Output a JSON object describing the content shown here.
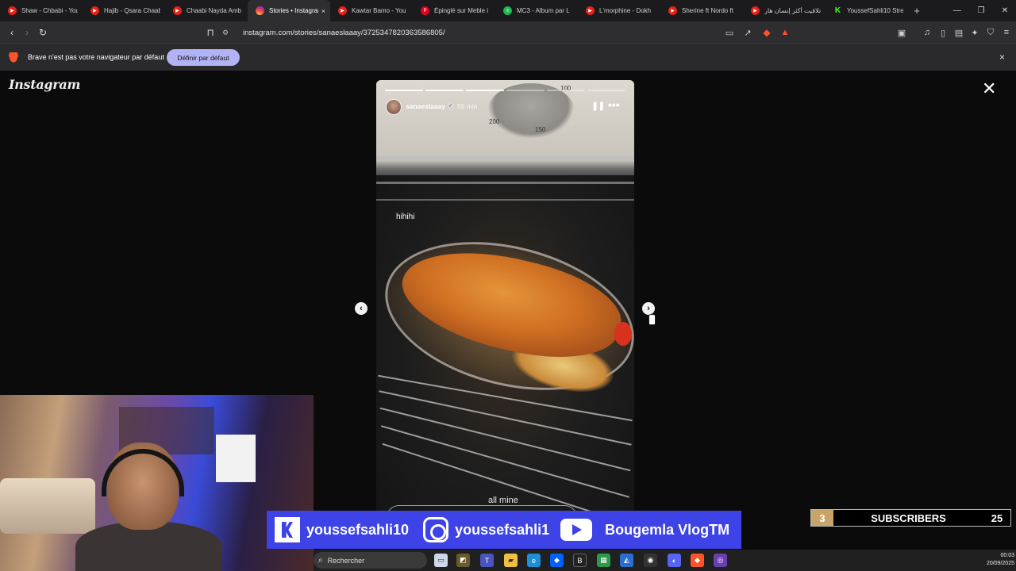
{
  "browser": {
    "tabs": [
      {
        "title": "Shaw - Chbabi - You",
        "icon": "youtube-icon"
      },
      {
        "title": "Hajib - Qsara Chaabi",
        "icon": "youtube-icon"
      },
      {
        "title": "Chaabi Nayda Amb",
        "icon": "youtube-icon"
      },
      {
        "title": "Stories • Instagram",
        "icon": "instagram-icon",
        "active": true
      },
      {
        "title": "Kawtar Bamo - You",
        "icon": "youtube-icon"
      },
      {
        "title": "Épinglé sur Meble i",
        "icon": "pinterest-icon"
      },
      {
        "title": "MC3 - Album par L",
        "icon": "spotify-icon"
      },
      {
        "title": "L'morphine - Dokh",
        "icon": "youtube-icon"
      },
      {
        "title": "Sherine ft Nordo ft",
        "icon": "youtube-icon"
      },
      {
        "title": "تلاقيت أكثر إنسان هار",
        "icon": "youtube-icon"
      },
      {
        "title": "YoussefSahli10 Stre",
        "icon": "kick-icon"
      }
    ],
    "new_tab": "+",
    "close_tab": "×",
    "url": "instagram.com/stories/sanaeslaaay/3725347820363586805/",
    "colors": {
      "brave": "#fb542b",
      "accent_button": "#b2b3f5"
    }
  },
  "infobar": {
    "message": "Brave n'est pas votre navigateur par défaut",
    "button": "Définir par défaut",
    "close": "×"
  },
  "instagram": {
    "logo": "Instagram",
    "close": "✕",
    "story": {
      "username": "sanaeslaaay",
      "time": "55 min",
      "caption_top": "hihihi",
      "caption_bottom": "all mine",
      "thermo_labels": [
        "100",
        "200",
        "150"
      ],
      "progress": {
        "segments": 6,
        "completed": 3
      }
    }
  },
  "overlay": {
    "kick": "youssefsahli10",
    "instagram": "youssefsahli1",
    "youtube": "Bougemla VlogTM",
    "subscribers_label": "SUBSCRIBERS",
    "subscribers_left": "3",
    "subscribers_right": "25",
    "colors": {
      "bar": "#3d43e6",
      "badge": "#c8a46a"
    }
  },
  "taskbar": {
    "search": "Rechercher",
    "time": "00:03",
    "date": "20/09/2025"
  }
}
